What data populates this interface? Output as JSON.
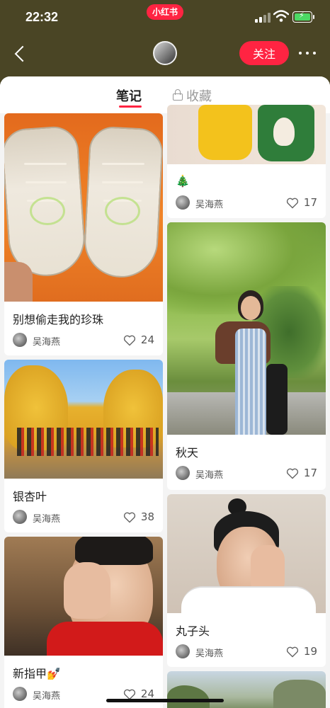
{
  "status_bar": {
    "time": "22:32",
    "app_badge": "小红书"
  },
  "nav": {
    "follow_label": "关注"
  },
  "tabs": {
    "notes": "笔记",
    "saved": "收藏"
  },
  "colors": {
    "accent": "#ff2442",
    "header_bg": "#4a4525"
  },
  "left_column": [
    {
      "title": "别想偷走我的珍珠",
      "author": "吴海燕",
      "likes": "24"
    },
    {
      "title": "银杏叶",
      "author": "吴海燕",
      "likes": "38"
    },
    {
      "title": "新指甲💅",
      "author": "吴海燕",
      "likes": "24"
    }
  ],
  "right_column": [
    {
      "title": "🎄",
      "author": "吴海燕",
      "likes": "17"
    },
    {
      "title": "秋天",
      "author": "吴海燕",
      "likes": "17"
    },
    {
      "title": "丸子头",
      "author": "吴海燕",
      "likes": "19"
    }
  ],
  "icons": [
    "back-arrow-icon",
    "more-dots-icon",
    "lock-icon",
    "heart-icon",
    "signal-icon",
    "wifi-icon",
    "battery-icon"
  ]
}
